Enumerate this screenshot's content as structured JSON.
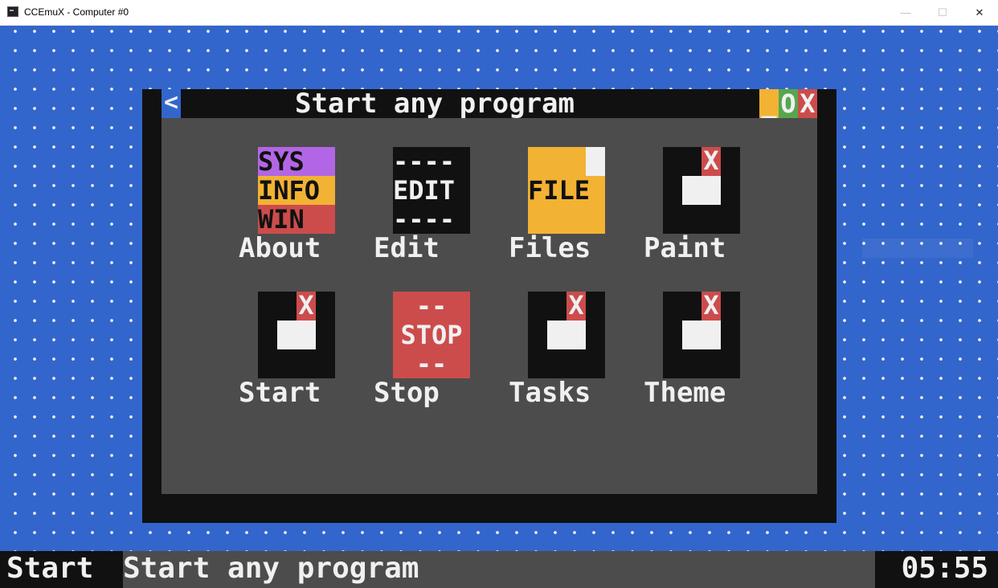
{
  "host_window": {
    "title": "CCEmuX - Computer #0",
    "controls": {
      "minimize": "—",
      "maximize": "☐",
      "close": "✕"
    }
  },
  "dialog": {
    "back_label": "<",
    "title": "Start any program",
    "buttons": {
      "minimize": "_",
      "maximize": "O",
      "close": "X"
    },
    "programs": [
      {
        "label": "About",
        "icon": "sysinfo-icon",
        "icon_rows": [
          "SYS",
          "INFO",
          "WIN"
        ]
      },
      {
        "label": "Edit",
        "icon": "edit-icon",
        "icon_rows": [
          "----",
          "EDIT",
          "----"
        ]
      },
      {
        "label": "Files",
        "icon": "file-icon",
        "icon_text": "FILE"
      },
      {
        "label": "Paint",
        "icon": "generic-program-icon",
        "icon_mark": "X"
      },
      {
        "label": "Start",
        "icon": "generic-program-icon",
        "icon_mark": "X"
      },
      {
        "label": "Stop",
        "icon": "stop-icon",
        "icon_rows": [
          "--",
          "STOP",
          "--"
        ]
      },
      {
        "label": "Tasks",
        "icon": "generic-program-icon",
        "icon_mark": "X"
      },
      {
        "label": "Theme",
        "icon": "generic-program-icon",
        "icon_mark": "X"
      }
    ]
  },
  "taskbar": {
    "start_label": "Start",
    "active_task": "Start any program",
    "clock": "05:55"
  },
  "colors": {
    "desktop": "#3366cc",
    "window_frame": "#111111",
    "window_body": "#4c4c4c",
    "text": "#f0f0f0",
    "orange": "#f2b233",
    "green": "#57a64e",
    "red": "#cc4c4c",
    "purple": "#b266e5"
  }
}
